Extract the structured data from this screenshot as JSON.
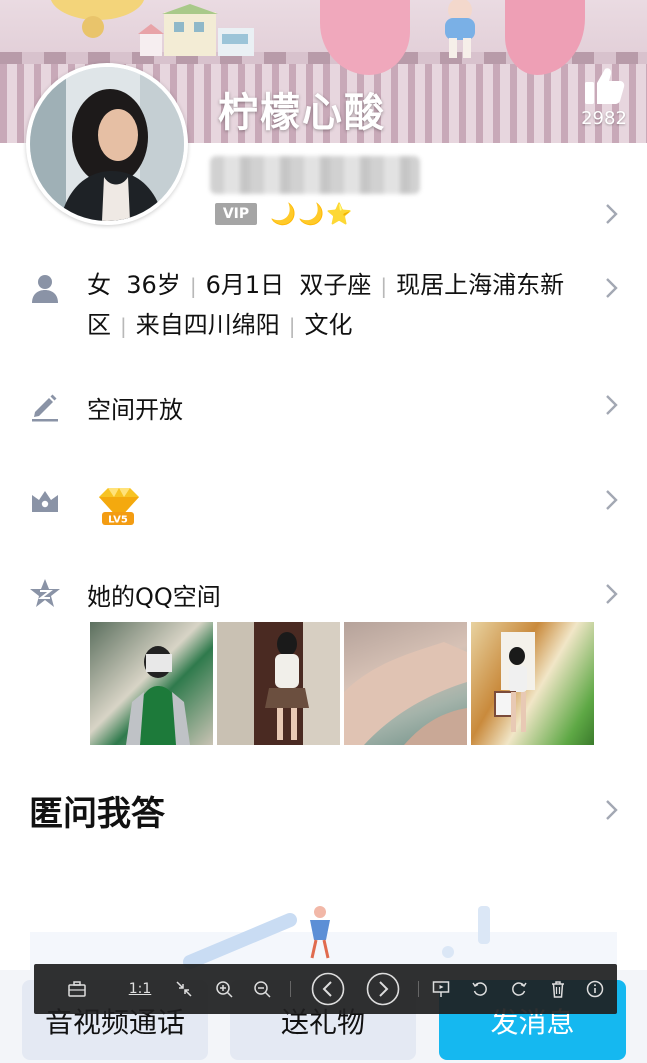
{
  "profile": {
    "nickname": "柠檬心酸",
    "like_count": "2982",
    "vip_label": "VIP",
    "level_icons": [
      "🌙",
      "🌙",
      "⭐"
    ]
  },
  "info": {
    "gender": "女",
    "age": "36岁",
    "birthday": "6月1日",
    "zodiac": "双子座",
    "residence": "现居上海浦东新区",
    "hometown": "来自四川绵阳",
    "industry": "文化"
  },
  "space_open": {
    "label": "空间开放"
  },
  "qq_level": {
    "badge_text": "LV5"
  },
  "qzone": {
    "label": "她的QQ空间",
    "photos": [
      "photo-1",
      "photo-2",
      "photo-3",
      "photo-4"
    ]
  },
  "qa": {
    "title": "匿问我答"
  },
  "actions": {
    "call": "音视频通话",
    "gift": "送礼物",
    "message": "发消息"
  },
  "viewer_toolbar": {
    "actual_size": "1:1"
  },
  "colors": {
    "accent": "#15b8f0",
    "secondary_button": "#e4e9f3",
    "icon_gray": "#8a93a6",
    "level_gold": "#f3b71a"
  }
}
